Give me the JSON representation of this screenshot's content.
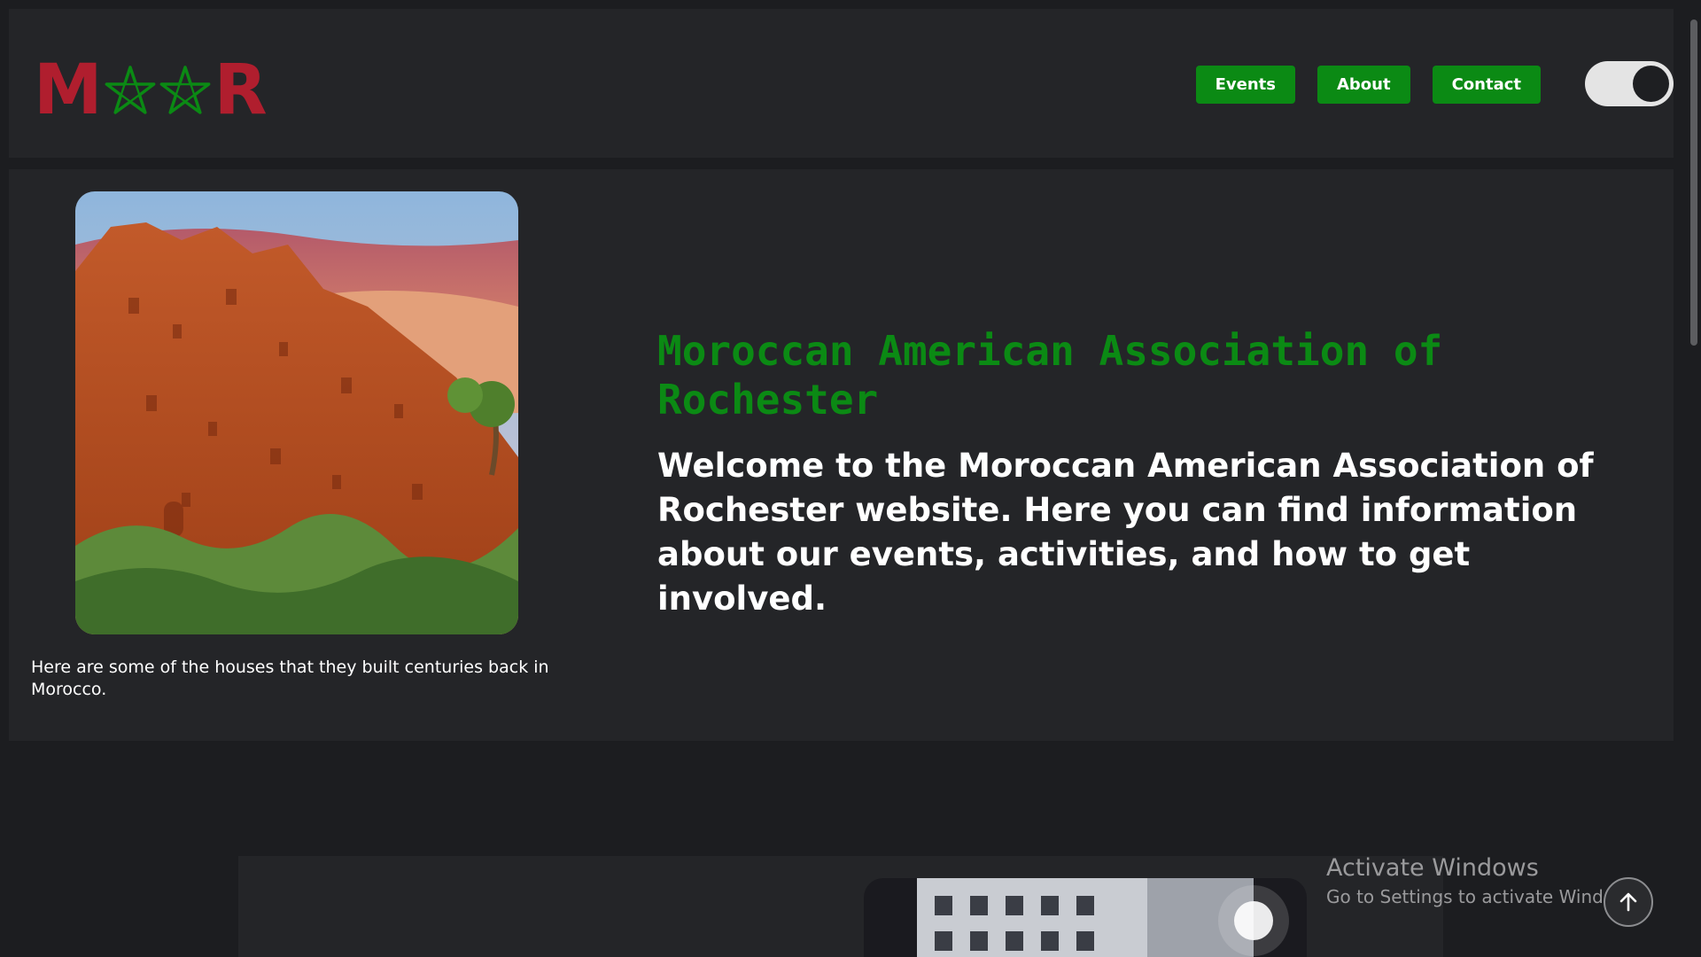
{
  "logo": {
    "letters": [
      "M",
      "R"
    ],
    "star_icon": "pentagram-star-icon",
    "colors": {
      "letters": "#b01e2e",
      "stars": "#0b8a14"
    }
  },
  "nav": {
    "items": [
      {
        "label": "Events"
      },
      {
        "label": "About"
      },
      {
        "label": "Contact"
      }
    ]
  },
  "theme_toggle": {
    "state": "dark"
  },
  "hero": {
    "image": "kasbah-photo",
    "caption": "Here are some of the houses that they built centuries back in Morocco.",
    "title": "Moroccan American Association of Rochester",
    "text": "Welcome to the Moroccan American Association of Rochester website. Here you can find information about our events, activities, and how to get involved."
  },
  "section2": {
    "image": "street-night-photo"
  },
  "watermark": {
    "title": "Activate Windows",
    "subtitle": "Go to Settings to activate Windows."
  },
  "back_to_top": {
    "icon": "arrow-up-icon"
  },
  "colors": {
    "accent": "#0b8a14",
    "brand_red": "#b01e2e",
    "page_bg": "#1c1d20",
    "panel_bg": "#242528"
  }
}
